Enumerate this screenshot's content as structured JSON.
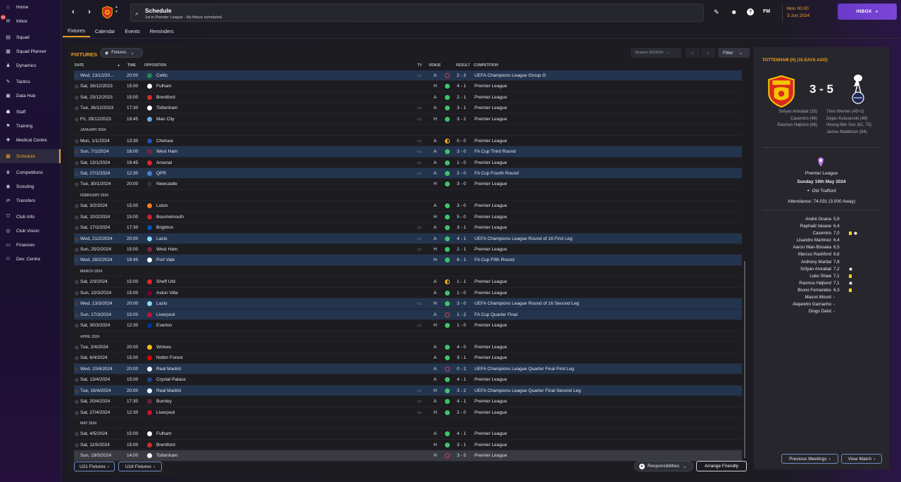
{
  "sidebar": {
    "items": [
      {
        "label": "Home",
        "icon": "home-icon",
        "glyph": "⌂"
      },
      {
        "label": "Inbox",
        "icon": "inbox-icon",
        "glyph": "✉",
        "badge": "63"
      },
      {
        "label": "Squad",
        "icon": "squad-icon",
        "glyph": "▤"
      },
      {
        "label": "Squad Planner",
        "icon": "squad-planner-icon",
        "glyph": "▦"
      },
      {
        "label": "Dynamics",
        "icon": "dynamics-icon",
        "glyph": "♟"
      },
      {
        "label": "Tactics",
        "icon": "tactics-icon",
        "glyph": "✎"
      },
      {
        "label": "Data Hub",
        "icon": "data-hub-icon",
        "glyph": "▣"
      },
      {
        "label": "Staff",
        "icon": "staff-icon",
        "glyph": "☗"
      },
      {
        "label": "Training",
        "icon": "training-icon",
        "glyph": "⚑"
      },
      {
        "label": "Medical Centre",
        "icon": "medical-icon",
        "glyph": "✚"
      },
      {
        "label": "Schedule",
        "icon": "calendar-icon",
        "glyph": "▦",
        "active": true
      },
      {
        "label": "Competitions",
        "icon": "trophy-icon",
        "glyph": "♛"
      },
      {
        "label": "Scouting",
        "icon": "scouting-icon",
        "glyph": "◉"
      },
      {
        "label": "Transfers",
        "icon": "transfers-icon",
        "glyph": "⇄"
      },
      {
        "label": "Club Info",
        "icon": "shield-icon",
        "glyph": "⛉"
      },
      {
        "label": "Club Vision",
        "icon": "vision-icon",
        "glyph": "◎"
      },
      {
        "label": "Finances",
        "icon": "finances-icon",
        "glyph": "▭"
      },
      {
        "label": "Dev. Centre",
        "icon": "dev-centre-icon",
        "glyph": "⚇"
      }
    ]
  },
  "header": {
    "title": "Schedule",
    "subtitle": "1st in Premier League - No fixture scheduled.",
    "date_time": "Mon 00:00",
    "date": "3 Jun 2024",
    "fm_label": "FM",
    "inbox_label": "INBOX"
  },
  "tabs": [
    "Fixtures",
    "Calendar",
    "Events",
    "Reminders"
  ],
  "fixtures": {
    "title": "FIXTURES",
    "view_dropdown": "Fixtures",
    "season": "Season 2023/24",
    "filter_label": "Filter",
    "columns": {
      "date": "DATE",
      "time": "TIME",
      "opposition": "OPPOSITION",
      "tv": "TV",
      "venue": "VENUE",
      "result": "RESULT",
      "competition": "COMPETITION"
    },
    "rows": [
      {
        "date": "Wed, 13/12/20...",
        "time": "20:00",
        "opp": "Celtic",
        "crest": "#1f8a4c",
        "tv": true,
        "venue": "A",
        "res": "loss",
        "score": "2 - 3",
        "comp": "UEFA Champions League Group G",
        "hl": true
      },
      {
        "date": "Sat, 16/12/2023",
        "time": "15:00",
        "opp": "Fulham",
        "crest": "#ffffff",
        "tv": false,
        "venue": "H",
        "res": "win",
        "score": "4 - 1",
        "comp": "Premier League"
      },
      {
        "date": "Sat, 23/12/2023",
        "time": "15:00",
        "opp": "Brentford",
        "crest": "#d62828",
        "tv": false,
        "venue": "A",
        "res": "win",
        "score": "2 - 1",
        "comp": "Premier League"
      },
      {
        "date": "Tue, 26/12/2023",
        "time": "17:30",
        "opp": "Tottenham",
        "crest": "#ffffff",
        "tv": true,
        "venue": "A",
        "res": "win",
        "score": "3 - 1",
        "comp": "Premier League"
      },
      {
        "date": "Fri, 29/12/2023",
        "time": "19:45",
        "opp": "Man City",
        "crest": "#6cabdd",
        "tv": true,
        "venue": "H",
        "res": "win",
        "score": "3 - 2",
        "comp": "Premier League"
      },
      {
        "section": "JANUARY 2024"
      },
      {
        "date": "Mon, 1/1/2024",
        "time": "13:30",
        "opp": "Chelsea",
        "crest": "#1f4fb0",
        "tv": true,
        "venue": "A",
        "res": "draw",
        "score": "0 - 0",
        "comp": "Premier League"
      },
      {
        "date": "Sun, 7/1/2024",
        "time": "16:00",
        "opp": "West Ham",
        "crest": "#7a263a",
        "tv": true,
        "venue": "A",
        "res": "win",
        "score": "3 - 0",
        "comp": "FA Cup Third Round",
        "hl": true
      },
      {
        "date": "Sat, 13/1/2024",
        "time": "19:45",
        "opp": "Arsenal",
        "crest": "#e0242a",
        "tv": true,
        "venue": "A",
        "res": "win",
        "score": "1 - 0",
        "comp": "Premier League"
      },
      {
        "date": "Sat, 27/1/2024",
        "time": "12:30",
        "opp": "QPR",
        "crest": "#4a7cc8",
        "tv": true,
        "venue": "A",
        "res": "win",
        "score": "2 - 0",
        "comp": "FA Cup Fourth Round",
        "hl": true
      },
      {
        "date": "Tue, 30/1/2024",
        "time": "20:00",
        "opp": "Newcastle",
        "crest": "#333333",
        "tv": false,
        "venue": "H",
        "res": "win",
        "score": "3 - 0",
        "comp": "Premier League"
      },
      {
        "section": "FEBRUARY 2024"
      },
      {
        "date": "Sat, 3/2/2024",
        "time": "15:00",
        "opp": "Luton",
        "crest": "#f47b20",
        "tv": false,
        "venue": "A",
        "res": "win",
        "score": "3 - 0",
        "comp": "Premier League"
      },
      {
        "date": "Sat, 10/2/2024",
        "time": "15:00",
        "opp": "Bournemouth",
        "crest": "#d11c28",
        "tv": false,
        "venue": "H",
        "res": "win",
        "score": "5 - 0",
        "comp": "Premier League"
      },
      {
        "date": "Sat, 17/2/2024",
        "time": "17:30",
        "opp": "Brighton",
        "crest": "#0057b8",
        "tv": true,
        "venue": "A",
        "res": "win",
        "score": "3 - 1",
        "comp": "Premier League"
      },
      {
        "date": "Wed, 21/2/2024",
        "time": "20:00",
        "opp": "Lazio",
        "crest": "#87d8f7",
        "tv": true,
        "venue": "A",
        "res": "win",
        "score": "4 - 1",
        "comp": "UEFA Champions League Round of 16 First Leg",
        "hl": true
      },
      {
        "date": "Sun, 25/2/2024",
        "time": "15:00",
        "opp": "West Ham",
        "crest": "#7a263a",
        "tv": true,
        "venue": "H",
        "res": "win",
        "score": "2 - 1",
        "comp": "Premier League"
      },
      {
        "date": "Wed, 28/2/2024",
        "time": "19:45",
        "opp": "Port Vale",
        "crest": "#ffffff",
        "tv": false,
        "venue": "H",
        "res": "win",
        "score": "6 - 1",
        "comp": "FA Cup Fifth Round",
        "hl": true
      },
      {
        "section": "MARCH 2024"
      },
      {
        "date": "Sat, 2/3/2024",
        "time": "15:00",
        "opp": "Sheff Utd",
        "crest": "#e4232b",
        "tv": false,
        "venue": "A",
        "res": "draw",
        "score": "1 - 1",
        "comp": "Premier League"
      },
      {
        "date": "Sun, 10/3/2024",
        "time": "15:00",
        "opp": "Aston Villa",
        "crest": "#7b003a",
        "tv": false,
        "venue": "A",
        "res": "win",
        "score": "1 - 0",
        "comp": "Premier League"
      },
      {
        "date": "Wed, 13/3/2024",
        "time": "20:00",
        "opp": "Lazio",
        "crest": "#87d8f7",
        "tv": true,
        "venue": "H",
        "res": "win",
        "score": "3 - 0",
        "comp": "UEFA Champions League Round of 16 Second Leg",
        "hl": true
      },
      {
        "date": "Sun, 17/3/2024",
        "time": "15:00",
        "opp": "Liverpool",
        "crest": "#c8102e",
        "tv": false,
        "venue": "A",
        "res": "loss",
        "score": "1 - 2",
        "comp": "FA Cup Quarter Final",
        "hl": true
      },
      {
        "date": "Sat, 30/3/2024",
        "time": "12:30",
        "opp": "Everton",
        "crest": "#003399",
        "tv": true,
        "venue": "H",
        "res": "win",
        "score": "1 - 0",
        "comp": "Premier League"
      },
      {
        "section": "APRIL 2024"
      },
      {
        "date": "Tue, 2/4/2024",
        "time": "20:00",
        "opp": "Wolves",
        "crest": "#fdb913",
        "tv": false,
        "venue": "A",
        "res": "win",
        "score": "4 - 0",
        "comp": "Premier League"
      },
      {
        "date": "Sat, 6/4/2024",
        "time": "15:00",
        "opp": "Nottm Forest",
        "crest": "#dd0000",
        "tv": false,
        "venue": "A",
        "res": "win",
        "score": "3 - 1",
        "comp": "Premier League"
      },
      {
        "date": "Wed, 10/4/2024",
        "time": "20:00",
        "opp": "Real Madrid",
        "crest": "#f4f4f4",
        "tv": false,
        "venue": "A",
        "res": "loss",
        "score": "0 - 2",
        "comp": "UEFA Champions League Quarter Final First Leg",
        "hl": true
      },
      {
        "date": "Sat, 13/4/2024",
        "time": "15:00",
        "opp": "Crystal Palace",
        "crest": "#1b458f",
        "tv": false,
        "venue": "A",
        "res": "win",
        "score": "4 - 1",
        "comp": "Premier League"
      },
      {
        "date": "Tue, 16/4/2024",
        "time": "20:00",
        "opp": "Real Madrid",
        "crest": "#f4f4f4",
        "tv": true,
        "venue": "H",
        "res": "win",
        "score": "3 - 2",
        "comp": "UEFA Champions League Quarter Final Second Leg",
        "hl": true
      },
      {
        "date": "Sat, 20/4/2024",
        "time": "17:30",
        "opp": "Burnley",
        "crest": "#6c1d45",
        "tv": true,
        "venue": "A",
        "res": "win",
        "score": "4 - 1",
        "comp": "Premier League"
      },
      {
        "date": "Sat, 27/4/2024",
        "time": "12:30",
        "opp": "Liverpool",
        "crest": "#c8102e",
        "tv": true,
        "venue": "H",
        "res": "win",
        "score": "2 - 0",
        "comp": "Premier League"
      },
      {
        "section": "MAY 2024"
      },
      {
        "date": "Sat, 4/5/2024",
        "time": "15:00",
        "opp": "Fulham",
        "crest": "#ffffff",
        "tv": false,
        "venue": "A",
        "res": "win",
        "score": "4 - 1",
        "comp": "Premier League"
      },
      {
        "date": "Sat, 11/5/2024",
        "time": "15:00",
        "opp": "Brentford",
        "crest": "#d62828",
        "tv": false,
        "venue": "H",
        "res": "win",
        "score": "3 - 1",
        "comp": "Premier League"
      },
      {
        "date": "Sun, 19/5/2024",
        "time": "14:00",
        "opp": "Tottenham",
        "crest": "#ffffff",
        "tv": false,
        "venue": "H",
        "res": "loss",
        "score": "3 - 5",
        "comp": "Premier League",
        "sel": true
      }
    ],
    "bottom": {
      "u21": "U21 Fixtures",
      "u18": "U18 Fixtures",
      "responsibilities": "Responsibilities",
      "arrange": "Arrange Friendly"
    }
  },
  "match": {
    "title": "TOTTENHAM (H) (15 DAYS AGO)",
    "score": "3 - 5",
    "home_scorers": [
      "Sofyan Amrabat (33)",
      "Casemiro (46)",
      "Rasmus Højlund (66)"
    ],
    "away_scorers": [
      "Timo Werner (45+1)",
      "Dejan Kulusevski (49)",
      "Heung-Min Son (62, 75)",
      "James Maddison (84)"
    ],
    "competition": "Premier League",
    "date": "Sunday 19th May 2024",
    "stadium": "Old Trafford",
    "attendance": "Attendance: 74.031 (3.000 Away)",
    "ratings": [
      {
        "name": "André Onana",
        "rating": "5,9",
        "ev": []
      },
      {
        "name": "Raphaël Varane",
        "rating": "6,4",
        "ev": []
      },
      {
        "name": "Casemiro",
        "rating": "7,0",
        "ev": [
          "y",
          "g"
        ]
      },
      {
        "name": "Lisandro Martínez",
        "rating": "6,4",
        "ev": []
      },
      {
        "name": "Aaron Wan-Bissaka",
        "rating": "6,5",
        "ev": []
      },
      {
        "name": "Marcus Rashford",
        "rating": "6,8",
        "ev": []
      },
      {
        "name": "Anthony Martial",
        "rating": "7,8",
        "ev": []
      },
      {
        "name": "Sofyan Amrabat",
        "rating": "7,2",
        "ev": [
          "g"
        ]
      },
      {
        "name": "Luke Shaw",
        "rating": "7,1",
        "ev": [
          "y"
        ]
      },
      {
        "name": "Rasmus Højlund",
        "rating": "7,1",
        "ev": [
          "g"
        ]
      },
      {
        "name": "Bruno Fernandes",
        "rating": "6,3",
        "ev": [
          "y"
        ]
      },
      {
        "name": "Mason Mount",
        "rating": "-",
        "ev": []
      },
      {
        "name": "Alejandro Garnacho",
        "rating": "-",
        "ev": []
      },
      {
        "name": "Diogo Dalot",
        "rating": "-",
        "ev": []
      }
    ],
    "prev_meetings": "Previous Meetings",
    "view_match": "View Match"
  },
  "colors": {
    "accent": "#f0a020",
    "win": "#3ec46a",
    "loss": "#e0414a",
    "draw": "#f0b020",
    "highlight_row": "#23344e",
    "inbox": "#7b46d8"
  }
}
